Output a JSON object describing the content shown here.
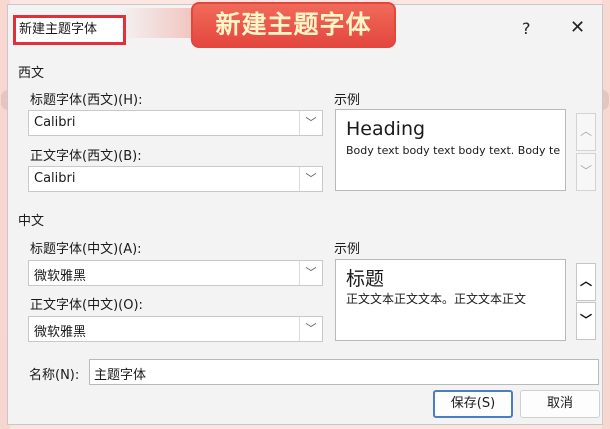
{
  "overlay_title": "新建主题字体",
  "dialog": {
    "title": "新建主题字体",
    "help": "?",
    "close": "✕"
  },
  "western": {
    "section": "西文",
    "heading_label": "标题字体(西文)(H):",
    "heading_value": "Calibri",
    "body_label": "正文字体(西文)(B):",
    "body_value": "Calibri",
    "sample_label": "示例",
    "sample_heading": "Heading",
    "sample_body": "Body text body text body text. Body te"
  },
  "chinese": {
    "section": "中文",
    "heading_label": "标题字体(中文)(A):",
    "heading_value": "微软雅黑",
    "body_label": "正文字体(中文)(O):",
    "body_value": "微软雅黑",
    "sample_label": "示例",
    "sample_heading": "标题",
    "sample_body": "正文文本正文文本。正文文本正文"
  },
  "name": {
    "label": "名称(N):",
    "value": "主题字体"
  },
  "buttons": {
    "save": "保存(S)",
    "cancel": "取消"
  },
  "icons": {
    "dropdown": "chevron-down-icon",
    "spin_up": "chevron-up-icon",
    "spin_down": "chevron-down-icon"
  }
}
